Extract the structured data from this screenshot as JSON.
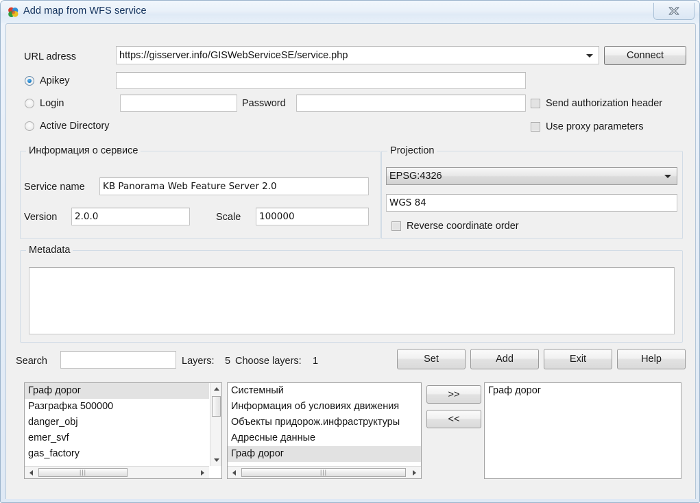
{
  "window": {
    "title": "Add map from WFS service",
    "icon": "panorama-logo-icon",
    "close_label": "close-icon"
  },
  "connection": {
    "url_label": "URL adress",
    "url_value": "https://gisserver.info/GISWebServiceSE/service.php",
    "connect_label": "Connect",
    "auth_modes": [
      {
        "label": "Apikey",
        "selected": true
      },
      {
        "label": "Login",
        "selected": false
      },
      {
        "label": "Active Directory",
        "selected": false
      }
    ],
    "apikey_value": "",
    "login_value": "",
    "password_label": "Password",
    "password_value": "",
    "send_auth_header": {
      "label": "Send authorization header",
      "checked": false
    },
    "use_proxy": {
      "label": "Use proxy parameters",
      "checked": false
    }
  },
  "service_info": {
    "group_title": "Информация о сервисе",
    "service_name_label": "Service name",
    "service_name_value": "KB Panorama Web Feature Server 2.0",
    "version_label": "Version",
    "version_value": "2.0.0",
    "scale_label": "Scale",
    "scale_value": "100000"
  },
  "projection": {
    "group_title": "Projection",
    "epsg_value": "EPSG:4326",
    "datum_value": "WGS 84",
    "reverse_order": {
      "label": "Reverse coordinate order",
      "checked": false
    }
  },
  "metadata": {
    "group_title": "Metadata",
    "value": ""
  },
  "search": {
    "label": "Search",
    "value": "",
    "placeholder": "",
    "layers_label": "Layers:",
    "layers_count": "5",
    "choose_label": "Choose layers:",
    "choose_count": "1"
  },
  "actions": {
    "set_label": "Set",
    "add_label": "Add",
    "exit_label": "Exit",
    "help_label": "Help"
  },
  "transfer": {
    "move_right_label": ">>",
    "move_left_label": "<<"
  },
  "lists": {
    "available": {
      "items": [
        {
          "text": "Граф дорог",
          "selected": true
        },
        {
          "text": "Разграфка 500000",
          "selected": false
        },
        {
          "text": "danger_obj",
          "selected": false
        },
        {
          "text": "emer_svf",
          "selected": false
        },
        {
          "text": "gas_factory",
          "selected": false
        }
      ]
    },
    "groups": {
      "items": [
        {
          "text": "Системный",
          "selected": false
        },
        {
          "text": "Информация об условиях движения",
          "selected": false
        },
        {
          "text": "Объекты придорож.инфраструктуры",
          "selected": false
        },
        {
          "text": "Адресные данные",
          "selected": false
        },
        {
          "text": "Граф дорог",
          "selected": true
        }
      ]
    },
    "chosen": {
      "items": [
        {
          "text": "Граф дорог",
          "selected": false
        }
      ]
    }
  },
  "colors": {
    "dialog_bg": "#f0f0f0",
    "titlebar_accent": "#dfeaf6",
    "title_text": "#11305b",
    "selection": "#e2e2e2",
    "group_border": "#d2dce6"
  }
}
